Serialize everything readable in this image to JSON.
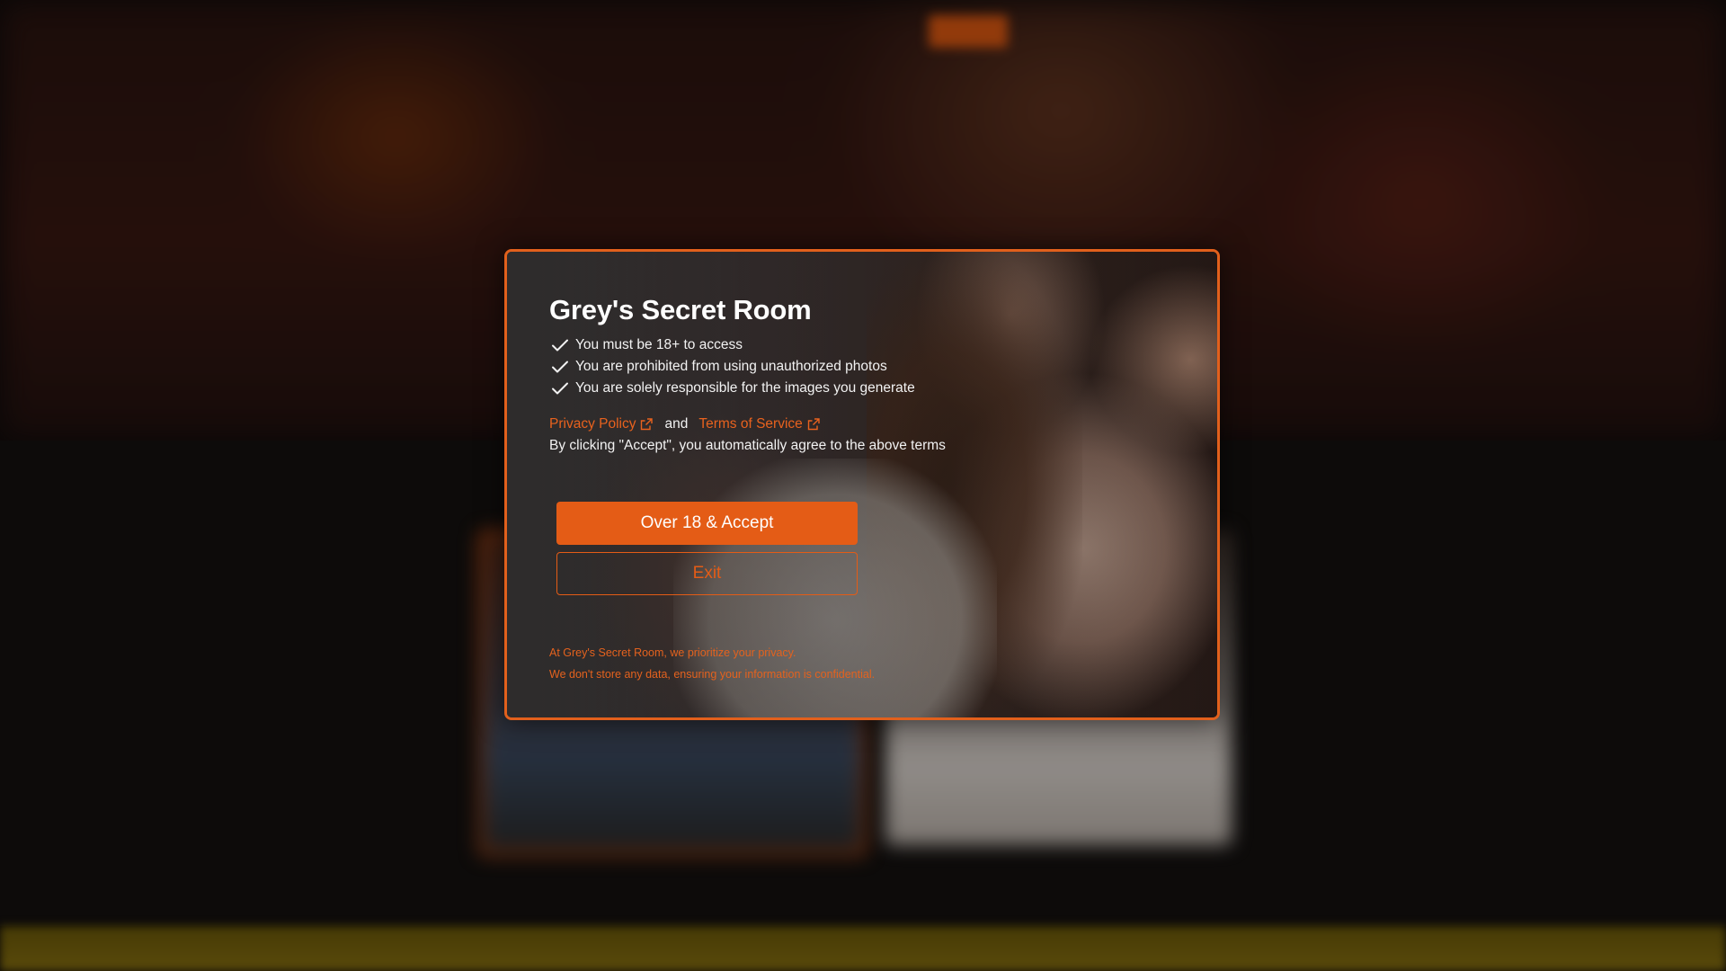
{
  "modal": {
    "title": "Grey's Secret Room",
    "checklist": [
      "You must be 18+ to access",
      "You are prohibited from using unauthorized photos",
      "You are solely responsible for the images you generate"
    ],
    "privacy_policy_label": "Privacy Policy",
    "and_label": "and",
    "terms_label": "Terms of Service",
    "agree_text": "By clicking \"Accept\", you automatically agree to the above terms",
    "accept_button": "Over 18 & Accept",
    "exit_button": "Exit",
    "privacy_note": [
      "At Grey's Secret Room, we prioritize your privacy.",
      "We don't store any data, ensuring your information is confidential."
    ]
  },
  "colors": {
    "accent": "#e45c16",
    "text": "#f2f2f2",
    "backdrop": "#0e0b0b"
  },
  "icons": [
    "check-icon",
    "external-link-icon"
  ]
}
